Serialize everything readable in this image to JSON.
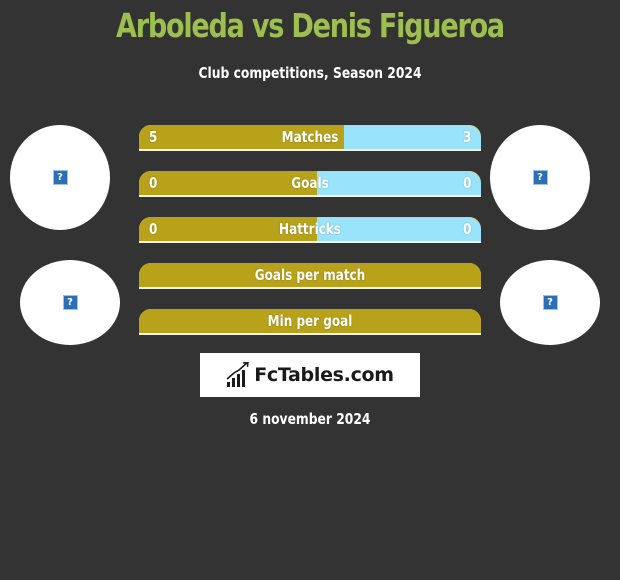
{
  "header": {
    "title": "Arboleda vs Denis Figueroa",
    "subtitle": "Club competitions, Season 2024"
  },
  "players": {
    "left": {
      "name": "Arboleda",
      "image_icon": "broken-image-icon",
      "club_icon": "broken-image-icon"
    },
    "right": {
      "name": "Denis Figueroa",
      "image_icon": "broken-image-icon",
      "club_icon": "broken-image-icon"
    }
  },
  "placeholder_glyph": "?",
  "stats": [
    {
      "label": "Matches",
      "left": "5",
      "right": "3",
      "left_share": 0.6
    },
    {
      "label": "Goals",
      "left": "0",
      "right": "0",
      "left_share": 0.52
    },
    {
      "label": "Hattricks",
      "left": "0",
      "right": "0",
      "left_share": 0.52
    },
    {
      "label": "Goals per match",
      "left": "",
      "right": "",
      "left_share": 1
    },
    {
      "label": "Min per goal",
      "left": "",
      "right": "",
      "left_share": 1
    }
  ],
  "colors": {
    "background": "#333333",
    "title": "#9dbf50",
    "left_bar": "#b8a21a",
    "right_bar": "#99e4fa"
  },
  "brand": {
    "name": "FcTables.com",
    "icon": "bar-chart-trend-icon"
  },
  "date": "6 november 2024"
}
